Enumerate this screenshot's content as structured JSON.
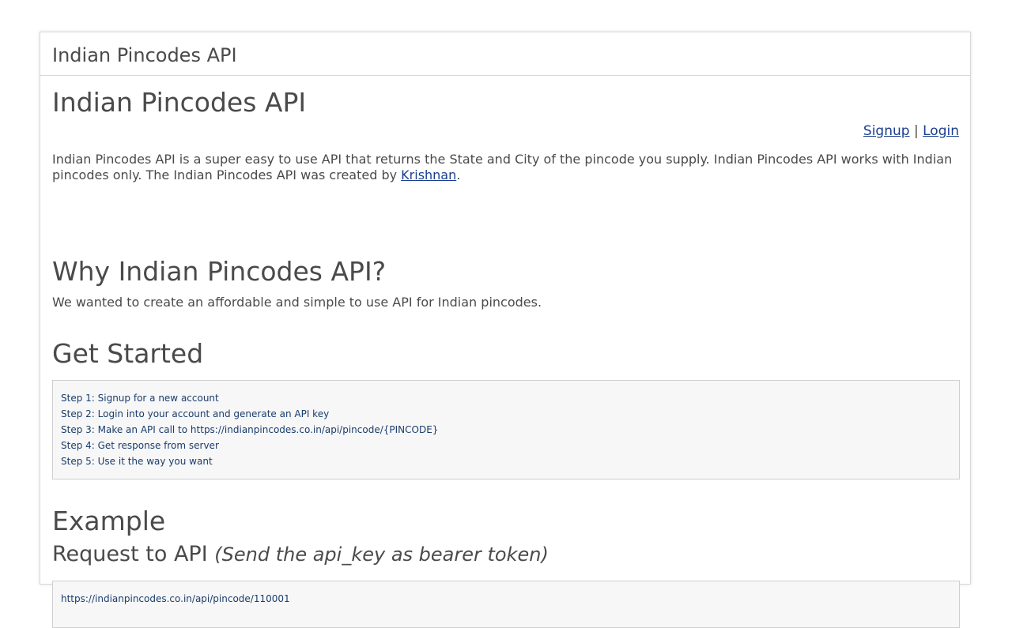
{
  "header": {
    "title": "Indian Pincodes API"
  },
  "main": {
    "title": "Indian Pincodes API",
    "auth": {
      "signup_label": "Signup",
      "separator": "|",
      "login_label": "Login"
    },
    "intro": {
      "text_before_link": "Indian Pincodes API is a super easy to use API that returns the State and City of the pincode you supply. Indian Pincodes API works with Indian pincodes only. The Indian Pincodes API was created by ",
      "author_link": "Krishnan",
      "text_after_link": "."
    },
    "why": {
      "title": "Why Indian Pincodes API?",
      "text": "We wanted to create an affordable and simple to use API for Indian pincodes."
    },
    "get_started": {
      "title": "Get Started",
      "steps": [
        "Step 1: Signup for a new account",
        "Step 2: Login into your account and generate an API key",
        "Step 3: Make an API call to https://indianpincodes.co.in/api/pincode/{PINCODE}",
        "Step 4: Get response from server",
        "Step 5: Use it the way you want"
      ]
    },
    "example": {
      "title": "Example",
      "request_title": "Request to API",
      "request_note": "(Send the api_key as bearer token)",
      "request_url": "https://indianpincodes.co.in/api/pincode/110001"
    }
  },
  "colors": {
    "text": "#4a4a4a",
    "link": "#1a3d8f",
    "code_text": "#1a3d6d",
    "code_bg": "#f7f7f7",
    "border": "#d8d8d8"
  }
}
